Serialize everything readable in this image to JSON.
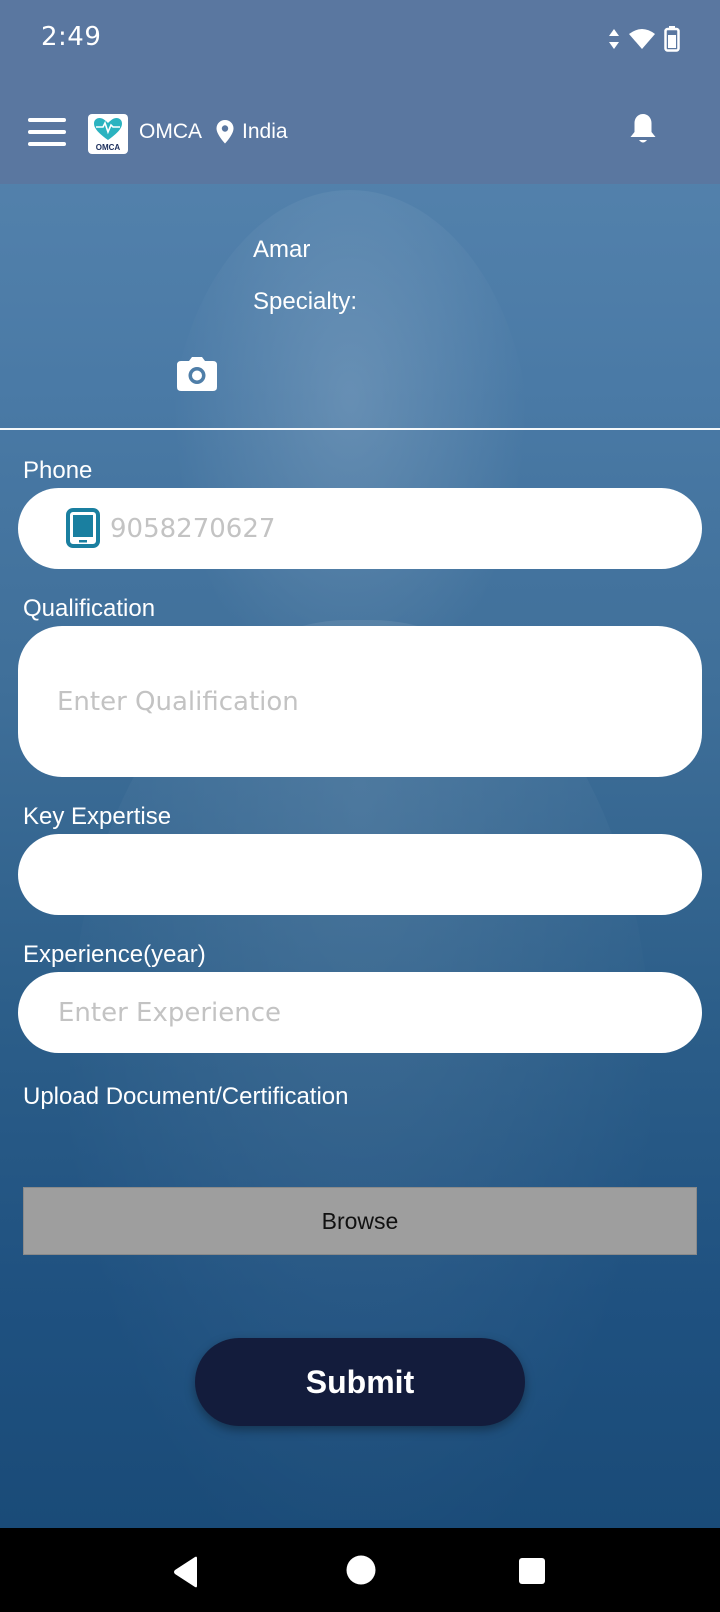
{
  "status_bar": {
    "time": "2:49"
  },
  "header": {
    "app_name": "OMCA",
    "logo_text": "OMCA",
    "location": "India"
  },
  "profile": {
    "name": "Amar",
    "specialty_label": "Specialty:"
  },
  "form": {
    "phone": {
      "label": "Phone",
      "placeholder": "9058270627"
    },
    "qualification": {
      "label": "Qualification",
      "placeholder": "Enter Qualification"
    },
    "key_expertise": {
      "label": "Key Expertise",
      "placeholder": ""
    },
    "experience": {
      "label": "Experience(year)",
      "placeholder": "Enter Experience"
    },
    "upload": {
      "label": "Upload Document/Certification",
      "browse_label": "Browse"
    },
    "submit_label": "Submit"
  },
  "colors": {
    "header_bg": "#5a77a0",
    "submit_bg": "#131c3c",
    "browse_bg": "#9e9e9e",
    "phone_icon": "#1a7fa0",
    "logo_heart": "#2bb3c0"
  },
  "icons": {
    "menu": "hamburger-menu-icon",
    "location": "location-pin-icon",
    "notifications": "bell-icon",
    "camera": "camera-icon",
    "phone": "tablet-phone-icon",
    "nav_back": "back-triangle-icon",
    "nav_home": "home-circle-icon",
    "nav_recents": "recents-square-icon"
  }
}
